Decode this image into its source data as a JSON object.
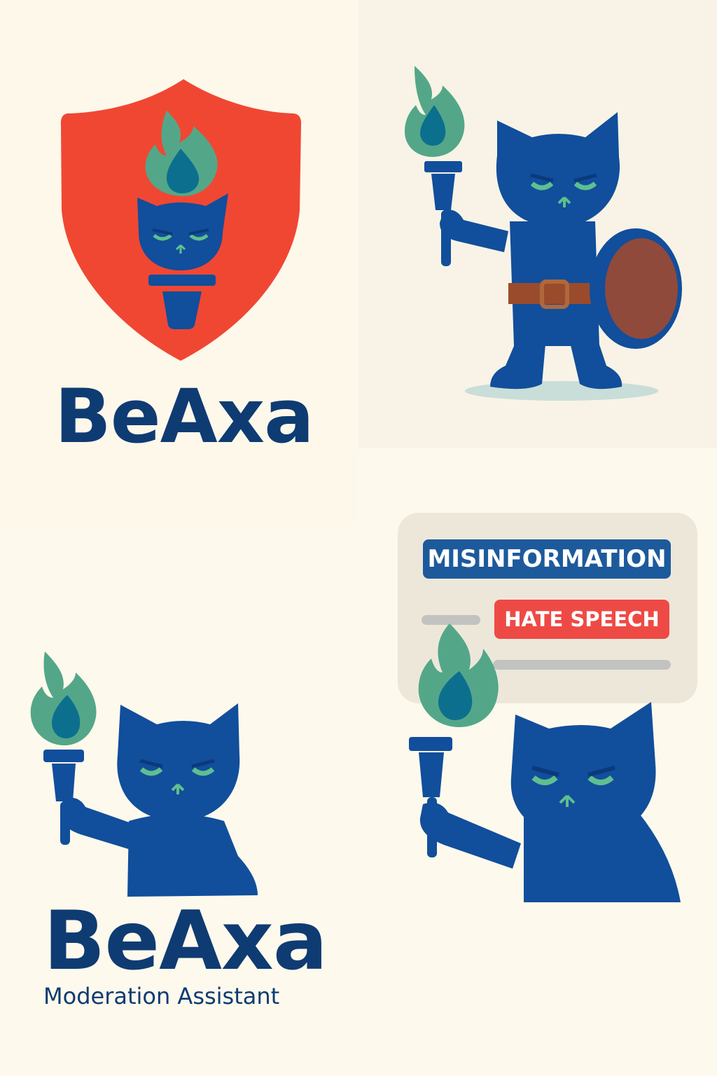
{
  "colors": {
    "navy_text": "#0f3b73",
    "cat_blue": "#114e9c",
    "flame_green": "#53a788",
    "flame_core": "#0d6f8e",
    "shield_red": "#f04733",
    "eye_green": "#5fbf8e",
    "tag_blue": "#1d5a9c",
    "tag_red": "#ee4a45",
    "belt_brown": "#9a4b2c",
    "shield_brown": "#8f4a3b"
  },
  "panel_logo_shield": {
    "wordmark": "BeAxa",
    "icons": [
      "shield-icon",
      "flame-icon",
      "cat-face-icon",
      "torch-icon"
    ]
  },
  "panel_warrior": {
    "icons": [
      "cat-warrior-icon",
      "torch-icon",
      "round-shield-icon",
      "belt-icon"
    ]
  },
  "panel_logo_mascot": {
    "wordmark": "BeAxa",
    "subtitle": "Moderation Assistant",
    "icons": [
      "cat-mascot-icon",
      "torch-icon"
    ]
  },
  "panel_moderation": {
    "tags": [
      "MISINFORMATION",
      "HATE SPEECH"
    ],
    "icons": [
      "cat-mascot-icon",
      "torch-icon"
    ]
  }
}
